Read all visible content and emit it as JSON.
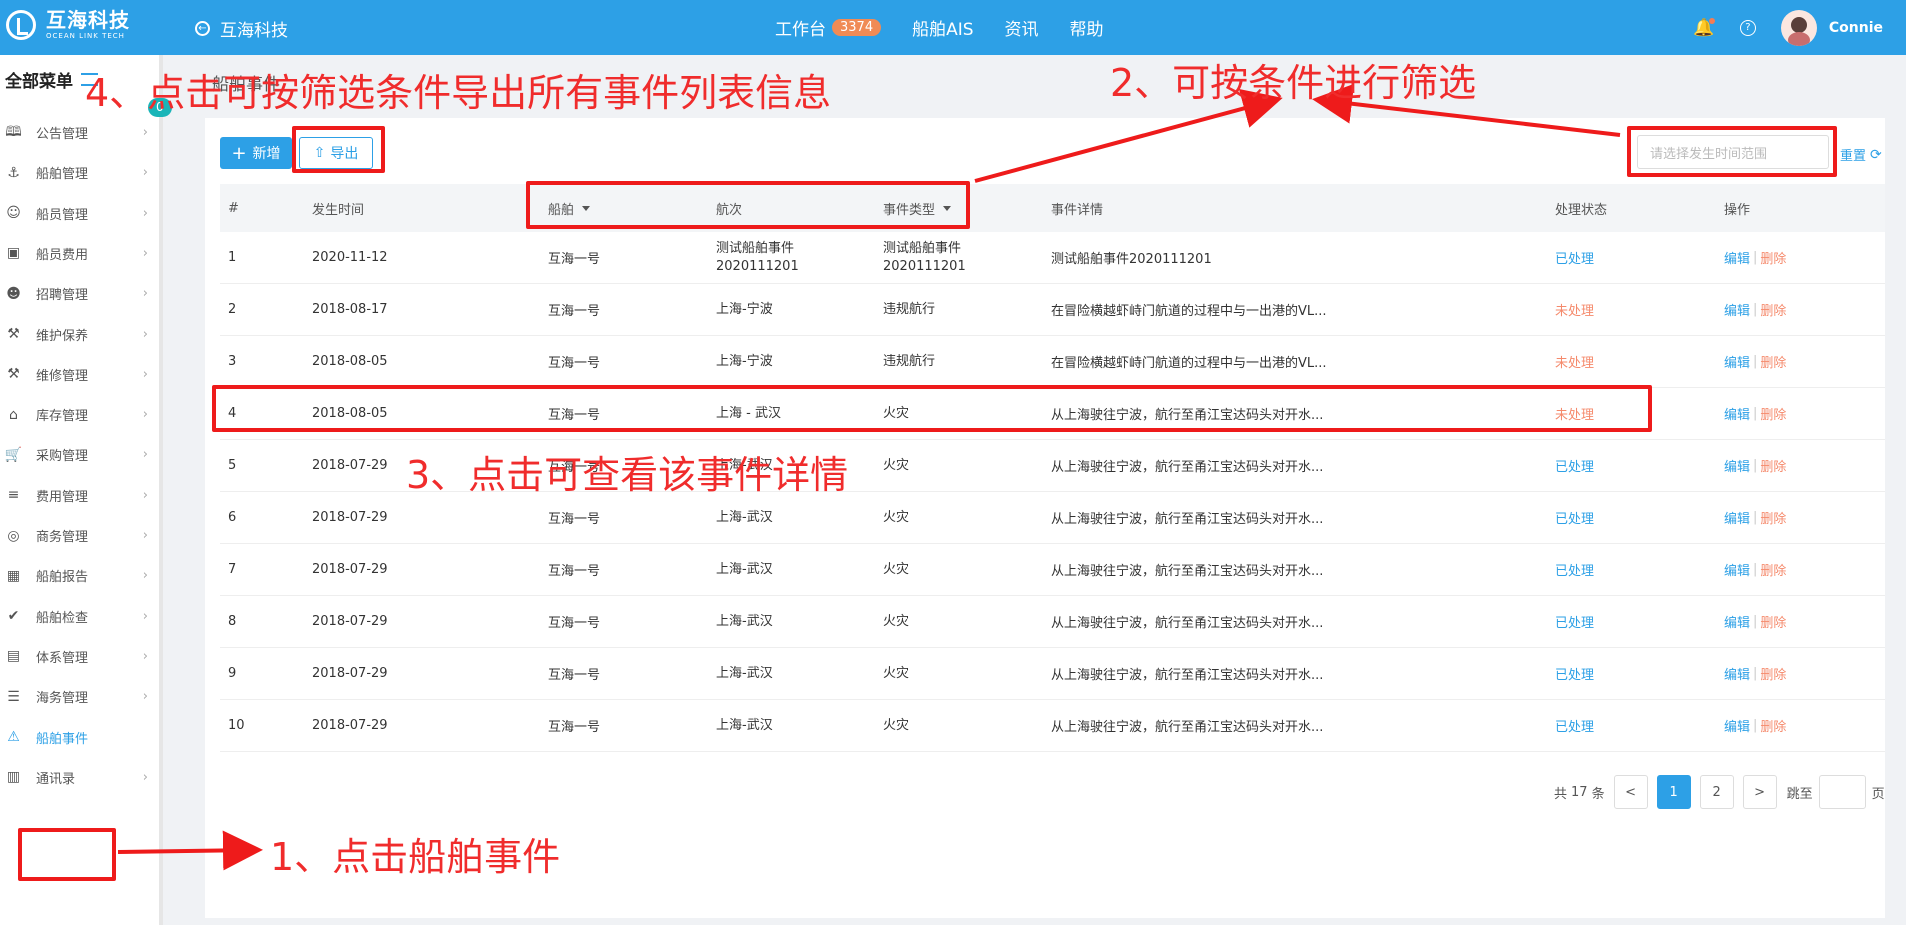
{
  "header": {
    "logo_cn": "互海科技",
    "logo_en": "OCEAN LINK TECH",
    "back_label": "互海科技",
    "nav": [
      {
        "label": "工作台",
        "badge": "3374"
      },
      {
        "label": "船舶AIS"
      },
      {
        "label": "资讯"
      },
      {
        "label": "帮助"
      }
    ],
    "user_name": "Connie"
  },
  "sidebar": {
    "title": "全部菜单",
    "items": [
      {
        "label": "公告管理",
        "icon": "book-icon",
        "badge": "0"
      },
      {
        "label": "船舶管理",
        "icon": "anchor-icon"
      },
      {
        "label": "船员管理",
        "icon": "person-icon"
      },
      {
        "label": "船员费用",
        "icon": "wallet-icon"
      },
      {
        "label": "招聘管理",
        "icon": "recruit-icon"
      },
      {
        "label": "维护保养",
        "icon": "tool-icon"
      },
      {
        "label": "维修管理",
        "icon": "wrench-icon"
      },
      {
        "label": "库存管理",
        "icon": "home-icon"
      },
      {
        "label": "采购管理",
        "icon": "cart-icon"
      },
      {
        "label": "费用管理",
        "icon": "coins-icon"
      },
      {
        "label": "商务管理",
        "icon": "globe-icon"
      },
      {
        "label": "船舶报告",
        "icon": "calendar-icon"
      },
      {
        "label": "船舶检查",
        "icon": "check-icon"
      },
      {
        "label": "体系管理",
        "icon": "docs-icon"
      },
      {
        "label": "海务管理",
        "icon": "sign-icon"
      },
      {
        "label": "船舶事件",
        "icon": "warning-icon",
        "active": true
      },
      {
        "label": "通讯录",
        "icon": "contacts-icon"
      }
    ]
  },
  "breadcrumb": "船舶事件",
  "toolbar": {
    "new_label": "新增",
    "export_label": "导出",
    "date_placeholder": "请选择发生时间范围",
    "reset_label": "重置"
  },
  "table": {
    "headers": [
      "#",
      "发生时间",
      "船舶",
      "航次",
      "事件类型",
      "事件详情",
      "处理状态",
      "操作"
    ],
    "rows": [
      {
        "no": "1",
        "date": "2020-11-12",
        "ship": "互海一号",
        "voyage": "测试船舶事件2020111201",
        "type": "测试船舶事件2020111201",
        "detail": "测试船舶事件2020111201",
        "status": "已处理",
        "done": true
      },
      {
        "no": "2",
        "date": "2018-08-17",
        "ship": "互海一号",
        "voyage": "上海-宁波",
        "type": "违规航行",
        "detail": "在冒险横越虾峙门航道的过程中与一出港的VL...",
        "status": "未处理",
        "done": false
      },
      {
        "no": "3",
        "date": "2018-08-05",
        "ship": "互海一号",
        "voyage": "上海-宁波",
        "type": "违规航行",
        "detail": "在冒险横越虾峙门航道的过程中与一出港的VL...",
        "status": "未处理",
        "done": false
      },
      {
        "no": "4",
        "date": "2018-08-05",
        "ship": "互海一号",
        "voyage": "上海 - 武汉",
        "type": "火灾",
        "detail": "从上海驶往宁波，航行至甬江宝达码头对开水...",
        "status": "未处理",
        "done": false
      },
      {
        "no": "5",
        "date": "2018-07-29",
        "ship": "互海一号",
        "voyage": "上海-武汉",
        "type": "火灾",
        "detail": "从上海驶往宁波，航行至甬江宝达码头对开水...",
        "status": "已处理",
        "done": true
      },
      {
        "no": "6",
        "date": "2018-07-29",
        "ship": "互海一号",
        "voyage": "上海-武汉",
        "type": "火灾",
        "detail": "从上海驶往宁波，航行至甬江宝达码头对开水...",
        "status": "已处理",
        "done": true
      },
      {
        "no": "7",
        "date": "2018-07-29",
        "ship": "互海一号",
        "voyage": "上海-武汉",
        "type": "火灾",
        "detail": "从上海驶往宁波，航行至甬江宝达码头对开水...",
        "status": "已处理",
        "done": true
      },
      {
        "no": "8",
        "date": "2018-07-29",
        "ship": "互海一号",
        "voyage": "上海-武汉",
        "type": "火灾",
        "detail": "从上海驶往宁波，航行至甬江宝达码头对开水...",
        "status": "已处理",
        "done": true
      },
      {
        "no": "9",
        "date": "2018-07-29",
        "ship": "互海一号",
        "voyage": "上海-武汉",
        "type": "火灾",
        "detail": "从上海驶往宁波，航行至甬江宝达码头对开水...",
        "status": "已处理",
        "done": true
      },
      {
        "no": "10",
        "date": "2018-07-29",
        "ship": "互海一号",
        "voyage": "上海-武汉",
        "type": "火灾",
        "detail": "从上海驶往宁波，航行至甬江宝达码头对开水...",
        "status": "已处理",
        "done": true
      }
    ],
    "edit_label": "编辑",
    "delete_label": "删除"
  },
  "pagination": {
    "total_prefix": "共",
    "total": "17",
    "total_suffix": "条",
    "prev": "<",
    "next": ">",
    "pages": [
      "1",
      "2"
    ],
    "current": "1",
    "jump_prefix": "跳至",
    "jump_suffix": "页"
  },
  "annotations": {
    "step1": "1、点击船舶事件",
    "step2": "2、可按条件进行筛选",
    "step3": "3、点击可查看该事件详情",
    "step4": "4、点击可按筛选条件导出所有事件列表信息",
    "color": "#ee1b1b"
  }
}
